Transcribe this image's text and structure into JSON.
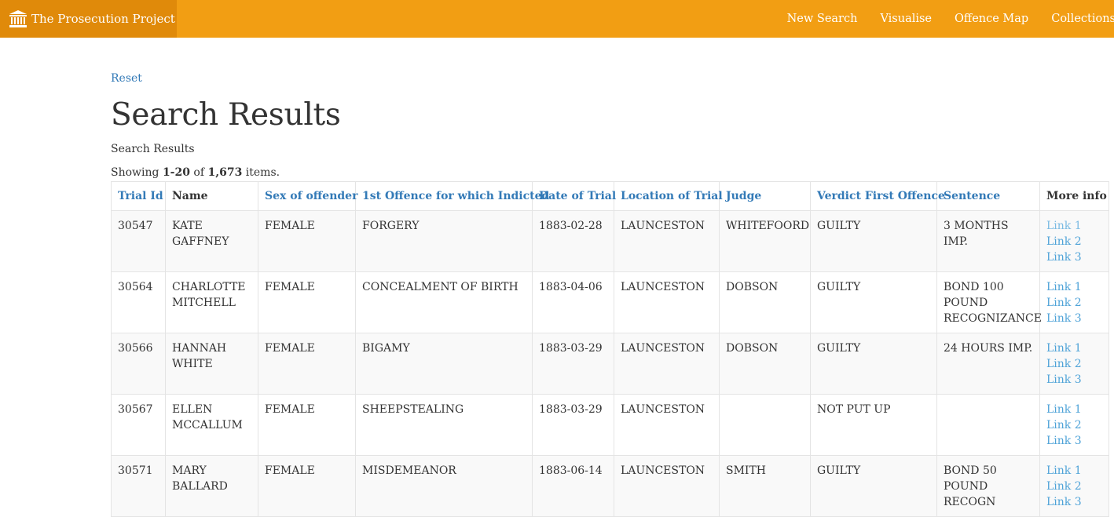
{
  "navbar": {
    "brand": "The Prosecution Project",
    "links": [
      "New Search",
      "Visualise",
      "Offence Map",
      "Collections"
    ]
  },
  "reset_label": "Reset",
  "page_title": "Search Results",
  "subtitle": "Search Results",
  "summary": {
    "prefix": "Showing ",
    "range": "1-20",
    "of": " of ",
    "total": "1,673",
    "suffix": " items."
  },
  "table": {
    "headers": [
      "Trial Id",
      "Name",
      "Sex of offender",
      "1st Offence for which Indicted",
      "Date of Trial",
      "Location of Trial",
      "Judge",
      "Verdict First Offence",
      "Sentence",
      "More info"
    ],
    "rows": [
      {
        "id": "30547",
        "name": "KATE GAFFNEY",
        "sex": "FEMALE",
        "offence": "FORGERY",
        "date": "1883-02-28",
        "location": "LAUNCESTON",
        "judge": "WHITEFOORD",
        "verdict": "GUILTY",
        "sentence": "3 MONTHS IMP.",
        "links": [
          "Link 1",
          "Link 2",
          "Link 3"
        ]
      },
      {
        "id": "30564",
        "name": "CHARLOTTE MITCHELL",
        "sex": "FEMALE",
        "offence": "CONCEALMENT OF BIRTH",
        "date": "1883-04-06",
        "location": "LAUNCESTON",
        "judge": "DOBSON",
        "verdict": "GUILTY",
        "sentence": "BOND 100 POUND RECOGNIZANCE",
        "links": [
          "Link 1",
          "Link 2",
          "Link 3"
        ]
      },
      {
        "id": "30566",
        "name": "HANNAH WHITE",
        "sex": "FEMALE",
        "offence": "BIGAMY",
        "date": "1883-03-29",
        "location": "LAUNCESTON",
        "judge": "DOBSON",
        "verdict": "GUILTY",
        "sentence": "24 HOURS IMP.",
        "links": [
          "Link 1",
          "Link 2",
          "Link 3"
        ]
      },
      {
        "id": "30567",
        "name": "ELLEN MCCALLUM",
        "sex": "FEMALE",
        "offence": "SHEEPSTEALING",
        "date": "1883-03-29",
        "location": "LAUNCESTON",
        "judge": "",
        "verdict": "NOT PUT UP",
        "sentence": "",
        "links": [
          "Link 1",
          "Link 2",
          "Link 3"
        ]
      },
      {
        "id": "30571",
        "name": "MARY BALLARD",
        "sex": "FEMALE",
        "offence": "MISDEMEANOR",
        "date": "1883-06-14",
        "location": "LAUNCESTON",
        "judge": "SMITH",
        "verdict": "GUILTY",
        "sentence": "BOND 50 POUND RECOGN",
        "links": [
          "Link 1",
          "Link 2",
          "Link 3"
        ]
      }
    ]
  }
}
